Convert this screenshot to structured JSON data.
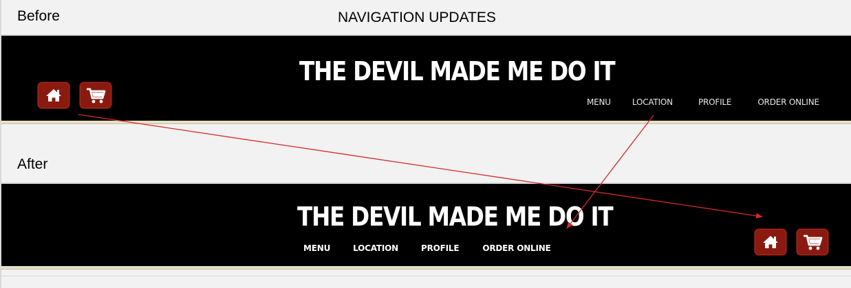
{
  "page": {
    "title": "NAVIGATION UPDATES",
    "before_label": "Before",
    "after_label": "After"
  },
  "before": {
    "brand": "THE DEVIL MADE ME DO IT",
    "nav": [
      "MENU",
      "LOCATION",
      "PROFILE",
      "ORDER ONLINE"
    ],
    "icons": [
      "home-icon",
      "cart-icon"
    ]
  },
  "after": {
    "brand": "THE DEVIL MADE ME DO IT",
    "nav": [
      "MENU",
      "LOCATION",
      "PROFILE",
      "ORDER ONLINE"
    ],
    "icons": [
      "home-icon",
      "cart-icon"
    ]
  },
  "colors": {
    "background": "#f2f2f2",
    "banner": "#000000",
    "icon_button": "#8a1a10",
    "annotation_arrow": "#d42a2a",
    "trim": "#e7dfc6"
  }
}
